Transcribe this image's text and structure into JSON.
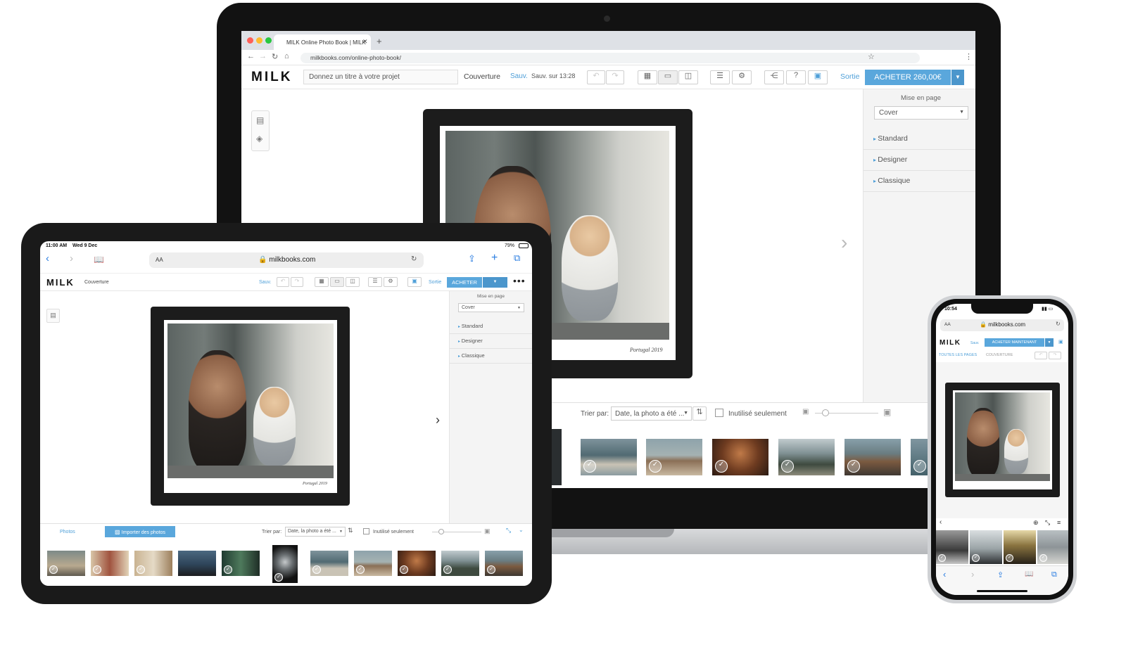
{
  "laptop": {
    "tab_title": "MILK Online Photo Book | MILK",
    "url": "milkbooks.com/online-photo-book/",
    "logo": "MILK",
    "title_placeholder": "Donnez un titre à votre projet",
    "page_name": "Couverture",
    "save_label": "Sauv.",
    "saved_at": "Sauv. sur 13:28",
    "exit_label": "Sortie",
    "buy_label": "ACHETER 260,00€",
    "panel_heading": "Mise en page",
    "layout_select": "Cover",
    "layout_items": [
      "Standard",
      "Designer",
      "Classique"
    ],
    "caption": "Portugal 2019",
    "sort_label": "Trier par:",
    "sort_value": "Date, la photo a été ...",
    "unused_label": "Inutilisé seulement"
  },
  "tablet": {
    "time": "11:00 AM",
    "date": "Wed 9 Dec",
    "battery": "79%",
    "aa": "AA",
    "url": "milkbooks.com",
    "logo": "MILK",
    "page_name": "Couverture",
    "save_label": "Sauv.",
    "exit_label": "Sortie",
    "buy_label": "ACHETER",
    "panel_heading": "Mise en page",
    "layout_select": "Cover",
    "layout_items": [
      "Standard",
      "Designer",
      "Classique"
    ],
    "caption": "Portugal 2019",
    "photos_tab": "Photos",
    "import_label": "Importer des photos",
    "sort_label": "Trier par:",
    "sort_value": "Date, la photo a été ...",
    "unused_label": "Inutilisé seulement"
  },
  "phone": {
    "time": "10:54",
    "aa": "AA",
    "url": "milkbooks.com",
    "logo": "MILK",
    "save_label": "Sauv.",
    "buy_label": "ACHETER MAINTENANT",
    "breadcrumb_all": "TOUTES LES PAGES",
    "breadcrumb_current": "COUVERTURE"
  },
  "colors": {
    "accent": "#5aa7dc",
    "link": "#4e9fd8",
    "device": "#121212"
  }
}
